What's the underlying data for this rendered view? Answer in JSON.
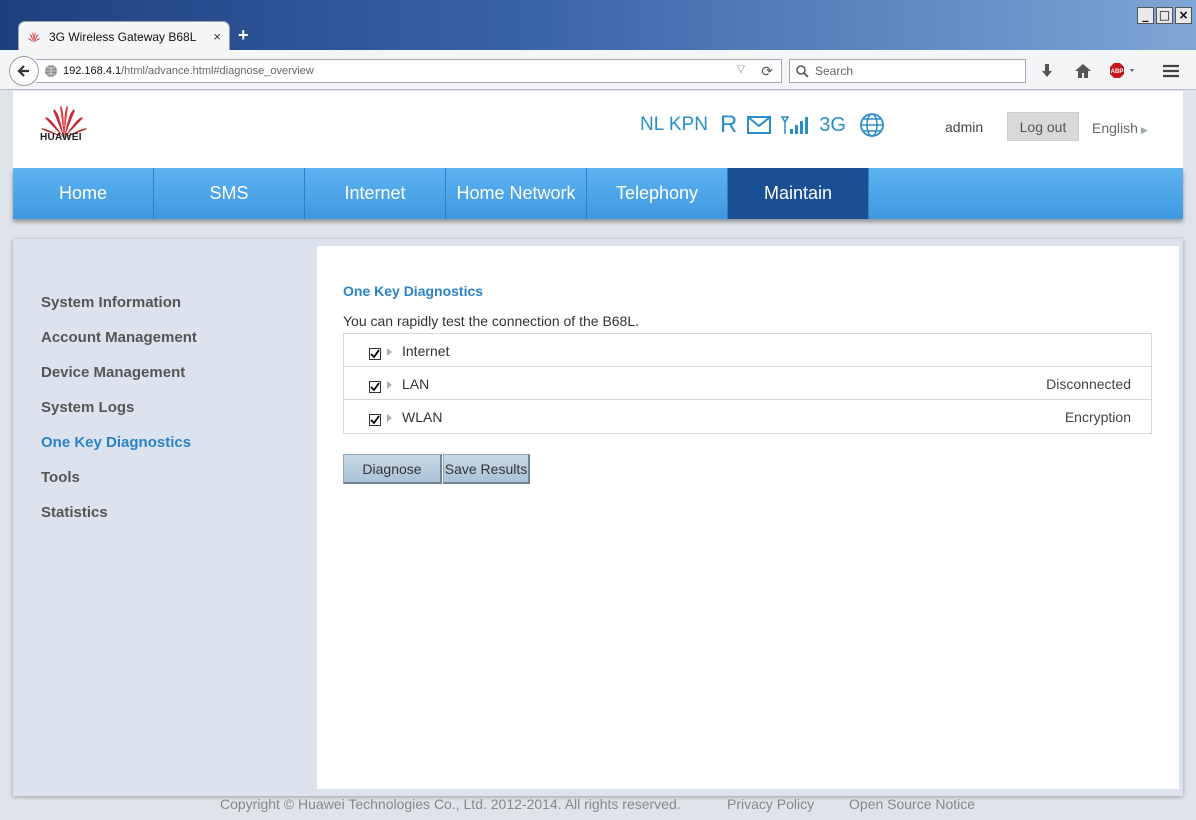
{
  "browser": {
    "tab_title": "3G Wireless Gateway B68L",
    "tab_close": "×",
    "new_tab": "+",
    "url_host": "192.168.4.1",
    "url_path": "/html/advance.html#diagnose_overview",
    "search_placeholder": "Search",
    "window_buttons": [
      "_",
      "□",
      "×"
    ],
    "icons": [
      "back-arrow-icon",
      "globe-icon",
      "reload-icon",
      "search-icon",
      "download-icon",
      "home-icon",
      "adblock-icon",
      "menu-icon"
    ]
  },
  "header": {
    "logo_text": "HUAWEI",
    "operator": "NL KPN",
    "roaming": "R",
    "network_type": "3G",
    "user": "admin",
    "logout_label": "Log out",
    "language": "English",
    "status_icons": [
      "mail-icon",
      "signal-icon",
      "globe-icon"
    ],
    "accent_color": "#2a8ec8"
  },
  "nav": {
    "items": [
      {
        "label": "Home"
      },
      {
        "label": "SMS"
      },
      {
        "label": "Internet"
      },
      {
        "label": "Home Network"
      },
      {
        "label": "Telephony"
      },
      {
        "label": "Maintain",
        "active": true
      }
    ],
    "bar_color": "#4aa3e8",
    "active_color": "#1b4f93"
  },
  "sidebar": {
    "items": [
      {
        "label": "System Information"
      },
      {
        "label": "Account Management"
      },
      {
        "label": "Device Management"
      },
      {
        "label": "System Logs"
      },
      {
        "label": "One Key Diagnostics",
        "active": true
      },
      {
        "label": "Tools"
      },
      {
        "label": "Statistics"
      }
    ]
  },
  "main": {
    "title": "One Key Diagnostics",
    "description": "You can rapidly test the connection of the B68L.",
    "rows": [
      {
        "label": "Internet",
        "checked": true,
        "status": ""
      },
      {
        "label": "LAN",
        "checked": true,
        "status": "Disconnected"
      },
      {
        "label": "WLAN",
        "checked": true,
        "status": "Encryption"
      }
    ],
    "diagnose_label": "Diagnose",
    "save_results_label": "Save Results"
  },
  "footer": {
    "copyright": "Copyright © Huawei Technologies Co., Ltd. 2012-2014. All rights reserved.",
    "privacy": "Privacy Policy",
    "open_source": "Open Source Notice"
  }
}
